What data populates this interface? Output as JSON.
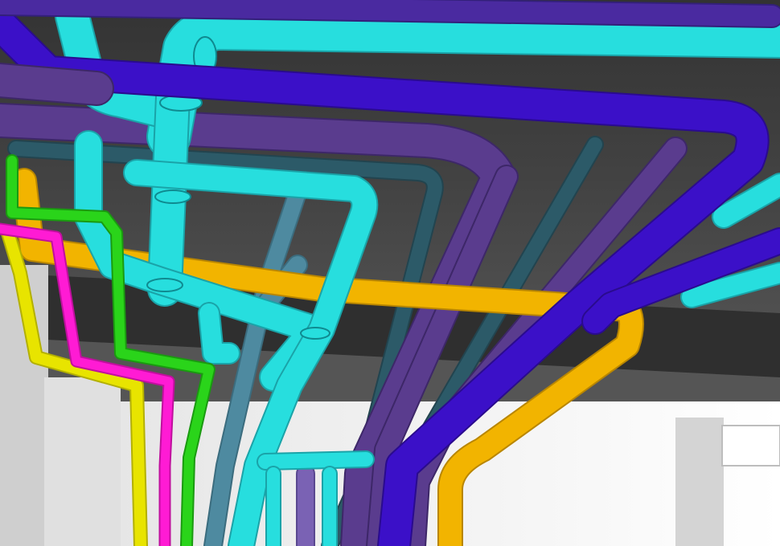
{
  "scene": {
    "palette": {
      "ceiling_dark": "#3a3a3a",
      "ceiling_mid": "#4d4d4d",
      "ceiling_light": "#6b6b6b",
      "wall_white": "#f4f4f4",
      "wall_grey": "#d9d9d9",
      "cyan": "#27dede",
      "cyan_shadow": "#1aa3a8",
      "blue": "#3b10c8",
      "indigo": "#4a2aa0",
      "purple": "#5a3c8e",
      "purple_light": "#7a62b4",
      "teal_dark": "#2c5a68",
      "steel_blue": "#4e8aa0",
      "yellow_orange": "#f2b400",
      "yellow": "#e8e400",
      "green": "#2ad41a",
      "magenta": "#ff1bd4"
    },
    "pipe_systems": [
      {
        "name": "cyan-pipe-system",
        "color_key": "cyan"
      },
      {
        "name": "blue-pipe-system",
        "color_key": "blue"
      },
      {
        "name": "purple-pipe-system",
        "color_key": "purple"
      },
      {
        "name": "teal-pipe-system",
        "color_key": "teal_dark"
      },
      {
        "name": "orange-pipe-system",
        "color_key": "yellow_orange"
      },
      {
        "name": "yellow-pipe-system",
        "color_key": "yellow"
      },
      {
        "name": "green-pipe-system",
        "color_key": "green"
      },
      {
        "name": "magenta-pipe-system",
        "color_key": "magenta"
      }
    ]
  }
}
